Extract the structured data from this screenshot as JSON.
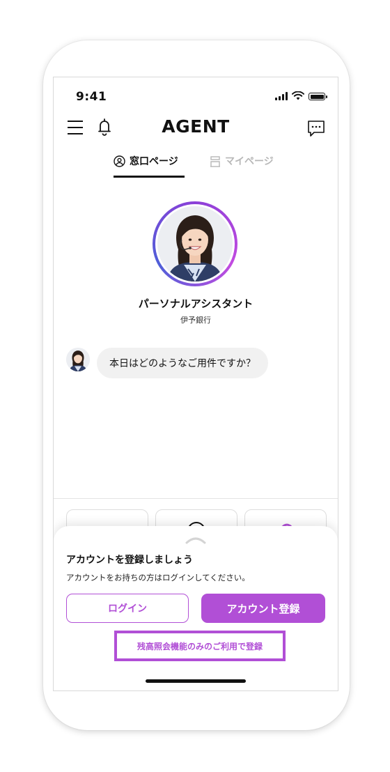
{
  "status_bar": {
    "time": "9:41"
  },
  "header": {
    "logo": "AGENT"
  },
  "tabs": [
    {
      "label": "窓口ページ",
      "active": true,
      "icon": "person-circle-icon"
    },
    {
      "label": "マイページ",
      "active": false,
      "icon": "building-icon"
    }
  ],
  "assistant": {
    "name": "パーソナルアシスタント",
    "organization": "伊予銀行"
  },
  "chat": {
    "messages": [
      {
        "text": "本日はどのようなご用件ですか？"
      }
    ]
  },
  "sheet": {
    "title": "アカウントを登録しましょう",
    "subtitle": "アカウントをお持ちの方はログインしてください。",
    "login_label": "ログイン",
    "register_label": "アカウント登録",
    "balance_only_link": "残高照会機能のみのご利用で登録"
  },
  "colors": {
    "accent": "#b14fd6",
    "text": "#111111",
    "inactive": "#b7b7b7"
  }
}
